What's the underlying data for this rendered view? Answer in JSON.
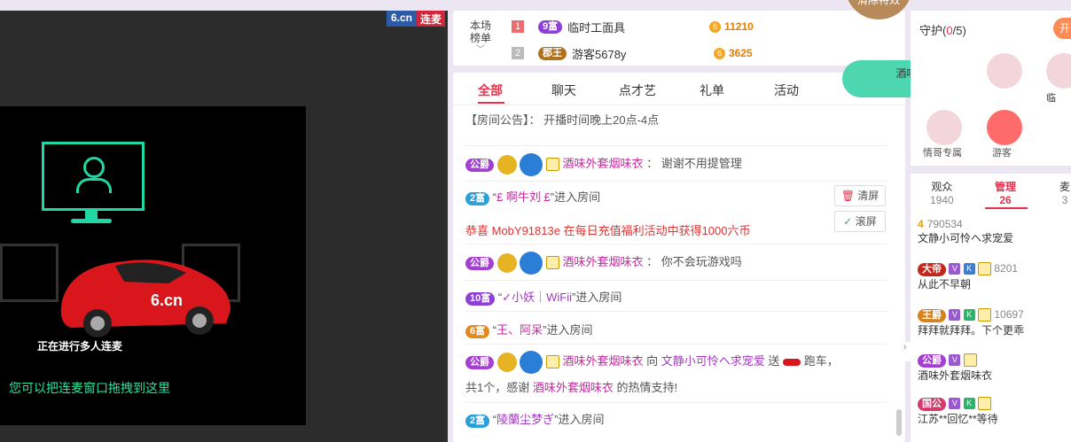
{
  "video": {
    "logo_site": "6.cn",
    "logo_mode": "连麦",
    "progress_text": "正在进行多人连麦",
    "drag_hint": "您可以把连麦窗口拖拽到这里"
  },
  "rank": {
    "title_line1": "本场",
    "title_line2": "榜单",
    "rows": [
      {
        "num": "1",
        "badge": "9富",
        "name": "临时工面具",
        "coins": "11210"
      },
      {
        "num": "2",
        "badge": "郡王",
        "name": "游客5678y",
        "coins": "3625"
      }
    ]
  },
  "effects": {
    "clear_label": "清除特效",
    "gift_sender": "酒味外套烟味衣",
    "gift_line": "跑车 1个"
  },
  "tabs": [
    "全部",
    "聊天",
    "点才艺",
    "礼单",
    "活动"
  ],
  "chat": {
    "notice_label": "【房间公告】：",
    "notice_text": "开播时间晚上20点-4点",
    "messages": [
      {
        "badge": "公爵",
        "user": "酒味外套烟味衣",
        "text": "谢谢不用提管理"
      },
      {
        "badge": "2富",
        "user": "£ 啊牛刘 £",
        "text": "进入房间"
      },
      {
        "system": "恭喜 MobY91813e 在每日充值福利活动中获得1000六币"
      },
      {
        "badge": "公爵",
        "user": "酒味外套烟味衣",
        "text": "你不会玩游戏吗"
      },
      {
        "badge": "10富",
        "user": "✓小妖｜WiFii",
        "text": "进入房间"
      },
      {
        "badge": "6富",
        "user": "王、阿呆",
        "text": "进入房间"
      },
      {
        "badge": "公爵",
        "user": "酒味外套烟味衣",
        "to": "向",
        "target": "文静小可怜ヘ求宠爱",
        "gift": "送",
        "gift_name": "跑车，",
        "line2": "共1个，感谢",
        "thanks_user": "酒味外套烟味衣",
        "thanks_end": "的热情支持!"
      },
      {
        "badge": "2富",
        "user": "陵蘭尘梦ぎ",
        "text": "进入房间"
      }
    ],
    "clear_btn": "清屏",
    "scroll_btn": "滚屏"
  },
  "guard": {
    "title": "守护",
    "count": "0",
    "max": "/5",
    "open_btn": "开",
    "items": [
      "",
      "",
      "临",
      "情哥专属",
      "游客"
    ]
  },
  "userlist": {
    "tabs": [
      {
        "label": "观众",
        "count": "1940"
      },
      {
        "label": "管理",
        "count": "26"
      },
      {
        "label": "麦",
        "count": "3"
      }
    ],
    "rows": [
      {
        "level": "4",
        "score": "790534",
        "name": "文静小可怜ヘ求宠爱"
      },
      {
        "badge": "大帝",
        "score": "8201",
        "name": "从此不早朝"
      },
      {
        "badge": "王爵",
        "score": "10697",
        "name": "拜拜就拜拜。下个更乖"
      },
      {
        "badge": "公爵",
        "score": "",
        "name": "酒味外套烟味衣"
      },
      {
        "badge": "国公",
        "score": "",
        "name": "江苏**回忆**等待"
      }
    ]
  },
  "colors": {
    "accent": "#e8304c",
    "teal": "#20d8a4",
    "gold": "#e6b422"
  }
}
